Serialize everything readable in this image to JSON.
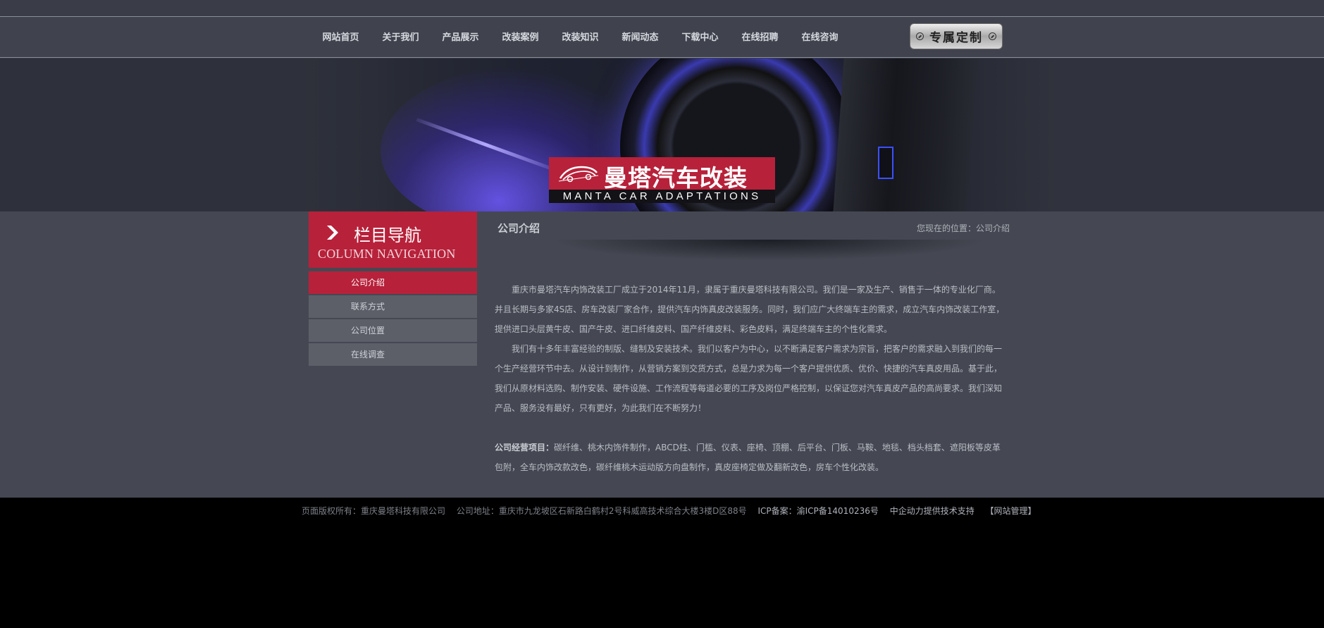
{
  "nav": {
    "items": [
      "网站首页",
      "关于我们",
      "产品展示",
      "改装案例",
      "改装知识",
      "新闻动态",
      "下载中心",
      "在线招聘",
      "在线咨询"
    ],
    "custom_button": "专属定制"
  },
  "banner": {
    "logo_cn": "曼塔汽车改装",
    "logo_en": "MANTA CAR ADAPTATIONS"
  },
  "sidebar": {
    "heading_cn": "栏目导航",
    "heading_en": "COLUMN NAVIGATION",
    "items": [
      {
        "label": "公司介绍",
        "active": true
      },
      {
        "label": "联系方式",
        "active": false
      },
      {
        "label": "公司位置",
        "active": false
      },
      {
        "label": "在线调查",
        "active": false
      }
    ]
  },
  "content": {
    "title": "公司介绍",
    "breadcrumb_prefix": "您现在的位置：",
    "breadcrumb_current": "公司介绍",
    "paragraphs": [
      "重庆市曼塔汽车内饰改装工厂成立于2014年11月，隶属于重庆曼塔科技有限公司。我们是一家及生产、销售于一体的专业化厂商。并且长期与多家4S店、房车改装厂家合作，提供汽车内饰真皮改装服务。同时，我们应广大终端车主的需求，成立汽车内饰改装工作室，提供进口头层黄牛皮、国产牛皮、进口纤维皮料、国产纤维皮料、彩色皮料，满足终端车主的个性化需求。",
      "我们有十多年丰富经验的制版、缝制及安装技术。我们以客户为中心，以不断满足客户需求为宗旨，把客户的需求融入到我们的每一个生产经营环节中去。从设计到制作，从营销方案到交货方式，总是力求为每一个客户提供优质、优价、快捷的汽车真皮用品。基于此，我们从原材料选购、制作安装、硬件设施、工作流程等每道必要的工序及岗位严格控制，以保证您对汽车真皮产品的高尚要求。我们深知产品、服务没有最好，只有更好，为此我们在不断努力！"
    ],
    "business_label": "公司经营项目：",
    "business_text": "碳纤维、桃木内饰件制作，ABCD柱、门槛、仪表、座椅、顶棚、后平台、门板、马鞍、地毯、档头档套、遮阳板等皮革包附，全车内饰改款改色，碳纤维桃木运动版方向盘制作，真皮座椅定做及翻新改色，房车个性化改装。"
  },
  "footer": {
    "copyright": "页面版权所有：重庆曼塔科技有限公司",
    "address": "公司地址：重庆市九龙坡区石新路白鹤村2号科威高技术综合大楼3楼D区88号",
    "icp": "ICP备案：渝ICP备14010236号",
    "support": "中企动力提供技术支持",
    "admin": "【网站管理】"
  },
  "colors": {
    "accent": "#b7213a",
    "nav_bg": "#40434d",
    "main_bg": "#454852",
    "footer_bg": "#000000"
  }
}
